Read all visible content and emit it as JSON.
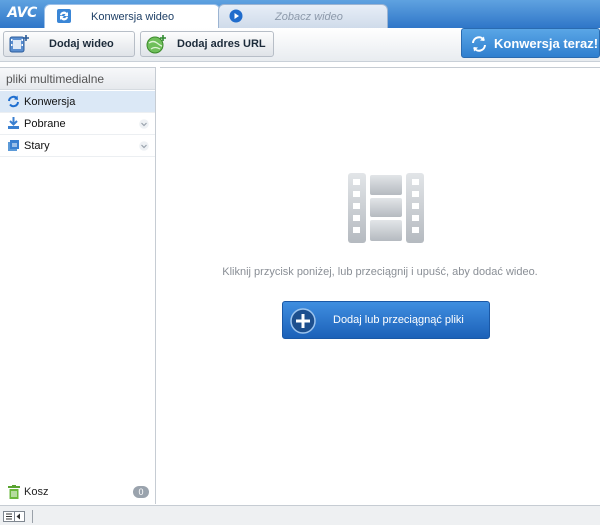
{
  "app": {
    "logo": "AVC"
  },
  "tabs": [
    {
      "label": "Konwersja wideo",
      "active": true
    },
    {
      "label": "Zobacz wideo",
      "active": false
    }
  ],
  "toolbar": {
    "add_video_label": "Dodaj wideo",
    "add_url_label": "Dodaj adres URL",
    "convert_label": "Konwersja teraz!"
  },
  "sidebar": {
    "header": "pliki multimedialne",
    "items": [
      {
        "label": "Konwersja",
        "icon": "refresh-icon",
        "selected": true
      },
      {
        "label": "Pobrane",
        "icon": "download-icon",
        "selected": false
      },
      {
        "label": "Stary",
        "icon": "archive-icon",
        "selected": false
      }
    ],
    "trash": {
      "label": "Kosz",
      "count": "0"
    }
  },
  "main": {
    "hint": "Kliknij przycisk poniżej, lub przeciągnij i upuść, aby dodać wideo.",
    "drop_button_label": "Dodaj lub przeciągnąć pliki"
  },
  "colors": {
    "accent": "#2f7fcf",
    "tabbar": "#3f86d2",
    "selected_row": "#dbe8f6"
  }
}
